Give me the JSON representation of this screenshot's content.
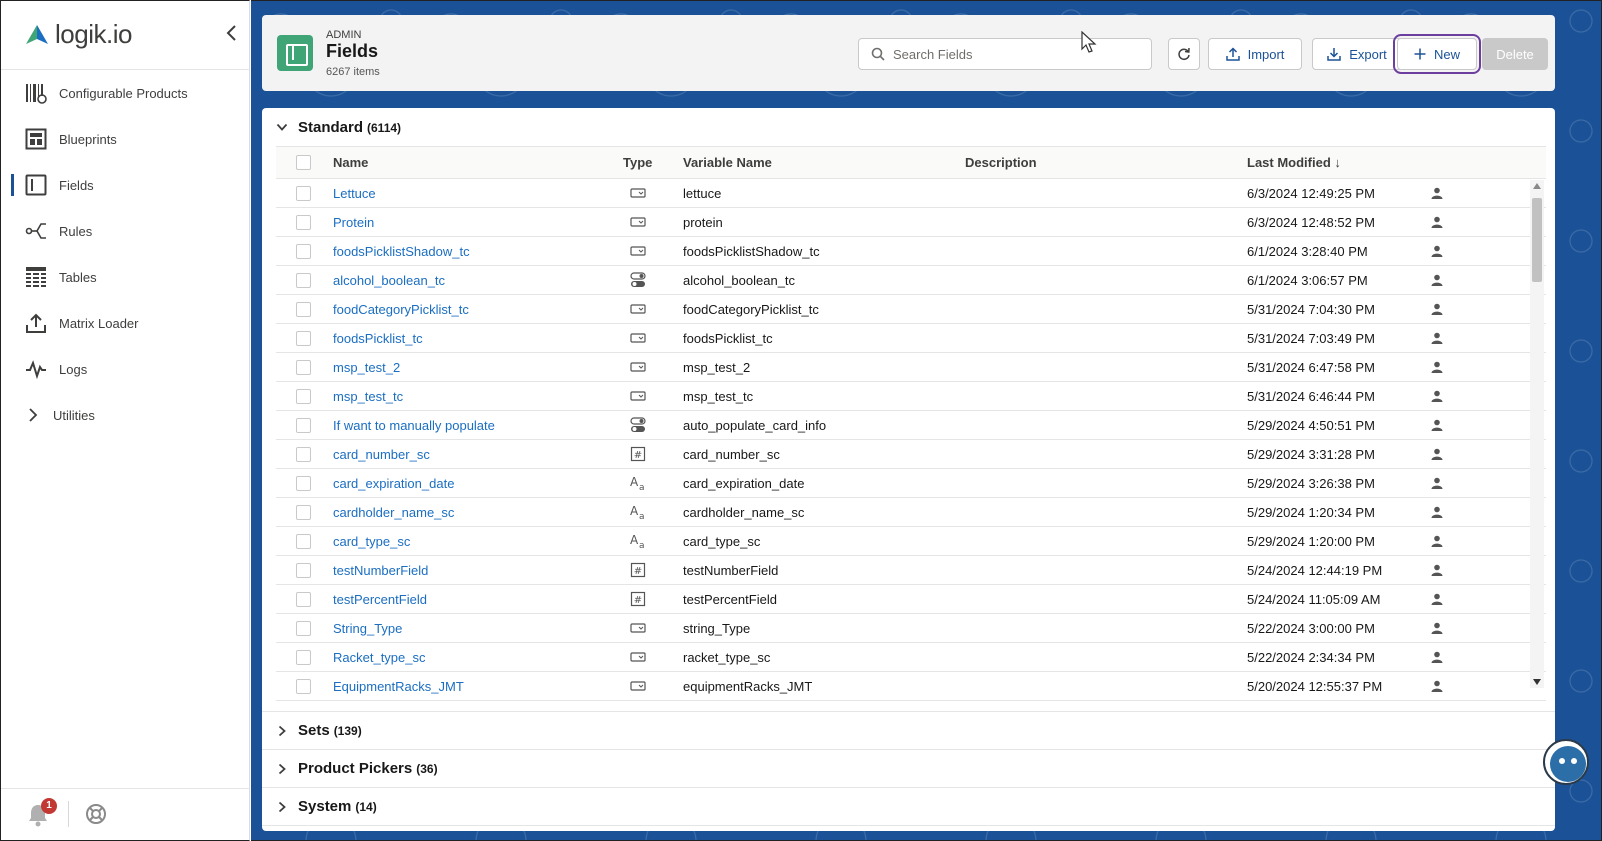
{
  "app": {
    "name": "logik.io"
  },
  "sidebar": {
    "items": [
      {
        "label": "Configurable Products",
        "icon": "barcode-icon"
      },
      {
        "label": "Blueprints",
        "icon": "blueprint-icon"
      },
      {
        "label": "Fields",
        "icon": "field-icon",
        "active": true
      },
      {
        "label": "Rules",
        "icon": "rules-icon"
      },
      {
        "label": "Tables",
        "icon": "table-icon"
      },
      {
        "label": "Matrix Loader",
        "icon": "upload-icon"
      },
      {
        "label": "Logs",
        "icon": "pulse-icon"
      },
      {
        "label": "Utilities",
        "icon": "chevron-right-icon"
      }
    ],
    "notification_count": "1"
  },
  "header": {
    "eyebrow": "ADMIN",
    "title": "Fields",
    "count": "6267 items",
    "search_placeholder": "Search Fields",
    "import_label": "Import",
    "export_label": "Export",
    "new_label": "New",
    "delete_label": "Delete"
  },
  "standard": {
    "title": "Standard",
    "count": "(6114)",
    "columns": {
      "name": "Name",
      "type": "Type",
      "variable": "Variable Name",
      "description": "Description",
      "modified": "Last Modified"
    },
    "rows": [
      {
        "name": "Lettuce",
        "type": "picklist",
        "variable": "lettuce",
        "modified": "6/3/2024 12:49:25 PM"
      },
      {
        "name": "Protein",
        "type": "picklist",
        "variable": "protein",
        "modified": "6/3/2024 12:48:52 PM"
      },
      {
        "name": "foodsPicklistShadow_tc",
        "type": "picklist",
        "variable": "foodsPicklistShadow_tc",
        "modified": "6/1/2024 3:28:40 PM"
      },
      {
        "name": "alcohol_boolean_tc",
        "type": "boolean",
        "variable": "alcohol_boolean_tc",
        "modified": "6/1/2024 3:06:57 PM"
      },
      {
        "name": "foodCategoryPicklist_tc",
        "type": "picklist",
        "variable": "foodCategoryPicklist_tc",
        "modified": "5/31/2024 7:04:30 PM"
      },
      {
        "name": "foodsPicklist_tc",
        "type": "picklist",
        "variable": "foodsPicklist_tc",
        "modified": "5/31/2024 7:03:49 PM"
      },
      {
        "name": "msp_test_2",
        "type": "picklist",
        "variable": "msp_test_2",
        "modified": "5/31/2024 6:47:58 PM"
      },
      {
        "name": "msp_test_tc",
        "type": "picklist",
        "variable": "msp_test_tc",
        "modified": "5/31/2024 6:46:44 PM"
      },
      {
        "name": "If want to manually populate",
        "type": "boolean",
        "variable": "auto_populate_card_info",
        "modified": "5/29/2024 4:50:51 PM"
      },
      {
        "name": "card_number_sc",
        "type": "number",
        "variable": "card_number_sc",
        "modified": "5/29/2024 3:31:28 PM"
      },
      {
        "name": "card_expiration_date",
        "type": "text",
        "variable": "card_expiration_date",
        "modified": "5/29/2024 3:26:38 PM"
      },
      {
        "name": "cardholder_name_sc",
        "type": "text",
        "variable": "cardholder_name_sc",
        "modified": "5/29/2024 1:20:34 PM"
      },
      {
        "name": "card_type_sc",
        "type": "text",
        "variable": "card_type_sc",
        "modified": "5/29/2024 1:20:00 PM"
      },
      {
        "name": "testNumberField",
        "type": "number",
        "variable": "testNumberField",
        "modified": "5/24/2024 12:44:19 PM"
      },
      {
        "name": "testPercentField",
        "type": "number",
        "variable": "testPercentField",
        "modified": "5/24/2024 11:05:09 AM"
      },
      {
        "name": "String_Type",
        "type": "picklist",
        "variable": "string_Type",
        "modified": "5/22/2024 3:00:00 PM"
      },
      {
        "name": "Racket_type_sc",
        "type": "picklist",
        "variable": "racket_type_sc",
        "modified": "5/22/2024 2:34:34 PM"
      },
      {
        "name": "EquipmentRacks_JMT",
        "type": "picklist",
        "variable": "equipmentRacks_JMT",
        "modified": "5/20/2024 12:55:37 PM"
      }
    ]
  },
  "sections": [
    {
      "title": "Sets",
      "count": "(139)"
    },
    {
      "title": "Product Pickers",
      "count": "(36)"
    },
    {
      "title": "System",
      "count": "(14)"
    }
  ]
}
